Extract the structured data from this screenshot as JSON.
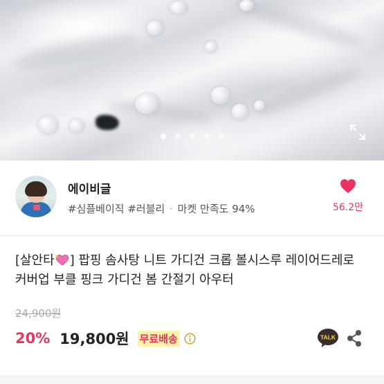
{
  "gallery": {
    "slide_count": 5,
    "active_slide": 0,
    "expand_icon": "expand-icon"
  },
  "seller": {
    "name": "에이비글",
    "tags": [
      "#심플베이직",
      "#러블리"
    ],
    "separator": "·",
    "satisfaction": "마켓 만족도 94%",
    "avatar_icon": "avatar"
  },
  "likes": {
    "count": "56.2만",
    "icon": "heart-icon",
    "color": "#e8345f"
  },
  "product": {
    "title_prefix": "[살안타",
    "title_emoji": "sparkling-heart-icon",
    "title_suffix": "] 팝핑 솜사탕 니트 가디건 크롭 볼시스루 레이어드레로  커버업 부클 핑크 가디건 봄 간절기 아우터",
    "original_price": "24,900원",
    "discount": "20%",
    "price": "19,800원",
    "shipping": "무료배송",
    "shipping_info_icon": "info-icon"
  },
  "actions": {
    "talk_label": "TALK",
    "talk_icon": "kakaotalk-icon",
    "share_icon": "share-icon"
  },
  "colors": {
    "accent": "#e8345f",
    "highlight": "#fff2a8",
    "text": "#222222",
    "muted": "#aaaaaa"
  }
}
